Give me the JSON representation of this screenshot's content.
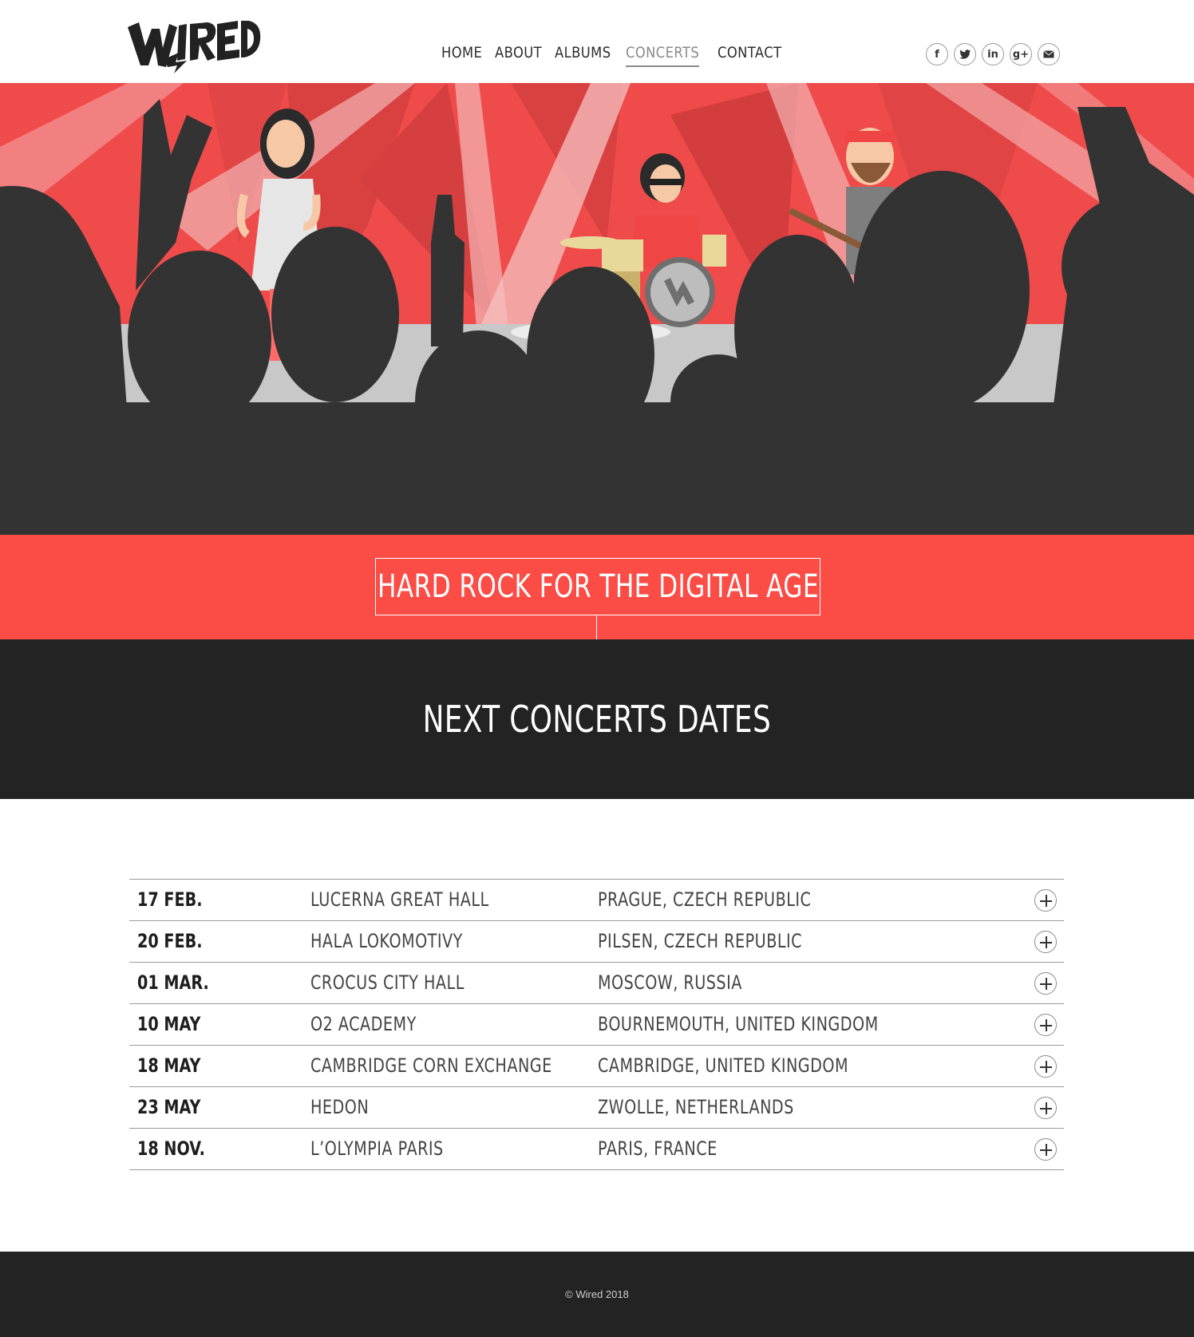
{
  "brand": {
    "logo_text": "WIRED"
  },
  "nav": {
    "items": [
      {
        "label": "HOME"
      },
      {
        "label": "ABOUT"
      },
      {
        "label": "ALBUMS"
      },
      {
        "label": "CONCERTS",
        "active": true
      },
      {
        "label": "CONTACT"
      }
    ]
  },
  "social": {
    "icons": [
      "facebook-icon",
      "twitter-icon",
      "linkedin-icon",
      "google-plus-icon",
      "mail-icon"
    ]
  },
  "hero": {
    "tagline": "HARD ROCK FOR THE DIGITAL AGE"
  },
  "section": {
    "title": "NEXT CONCERTS DATES"
  },
  "concerts": [
    {
      "date": "17 FEB.",
      "venue": "LUCERNA GREAT HALL",
      "city": "PRAGUE, CZECH REPUBLIC"
    },
    {
      "date": "20 FEB.",
      "venue": "HALA LOKOMOTIVY",
      "city": "PILSEN, CZECH REPUBLIC"
    },
    {
      "date": "01 MAR.",
      "venue": "CROCUS CITY HALL",
      "city": "MOSCOW, RUSSIA"
    },
    {
      "date": "10 MAY",
      "venue": "O2 ACADEMY",
      "city": "BOURNEMOUTH, UNITED KINGDOM"
    },
    {
      "date": "18 MAY",
      "venue": "CAMBRIDGE CORN EXCHANGE",
      "city": "CAMBRIDGE, UNITED KINGDOM"
    },
    {
      "date": "23 MAY",
      "venue": "HEDON",
      "city": "ZWOLLE, NETHERLANDS"
    },
    {
      "date": "18 NOV.",
      "venue": "L’OLYMPIA PARIS",
      "city": "PARIS, FRANCE"
    }
  ],
  "footer": {
    "copyright": "© Wired 2018"
  },
  "colors": {
    "accent": "#fb4c46",
    "dark": "#232323",
    "stage_red": "#ef4b4b"
  }
}
